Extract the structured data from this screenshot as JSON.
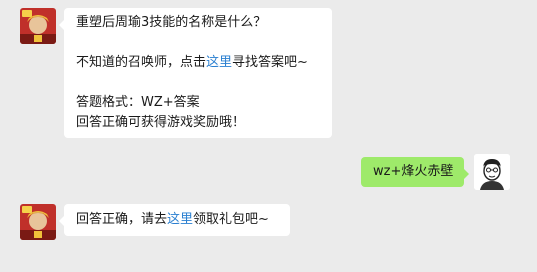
{
  "messages": [
    {
      "sender": "bot",
      "avatar_icon": "game-hero-avatar-icon",
      "lines": {
        "question": "重塑后周瑜3技能的名称是什么？",
        "hint_prefix": "不知道的召唤师，点击",
        "hint_link": "这里",
        "hint_suffix": "寻找答案吧~",
        "format": "答题格式：WZ+答案",
        "reward": "回答正确可获得游戏奖励哦！"
      }
    },
    {
      "sender": "user",
      "avatar_icon": "user-portrait-avatar-icon",
      "text": "wz+烽火赤壁"
    },
    {
      "sender": "bot",
      "avatar_icon": "game-hero-avatar-icon",
      "lines": {
        "prefix": "回答正确，请去",
        "link": "这里",
        "suffix": "领取礼包吧~"
      }
    }
  ],
  "colors": {
    "background": "#ebebeb",
    "bot_bubble": "#ffffff",
    "user_bubble": "#9eea6a",
    "link": "#2a7fd0"
  }
}
